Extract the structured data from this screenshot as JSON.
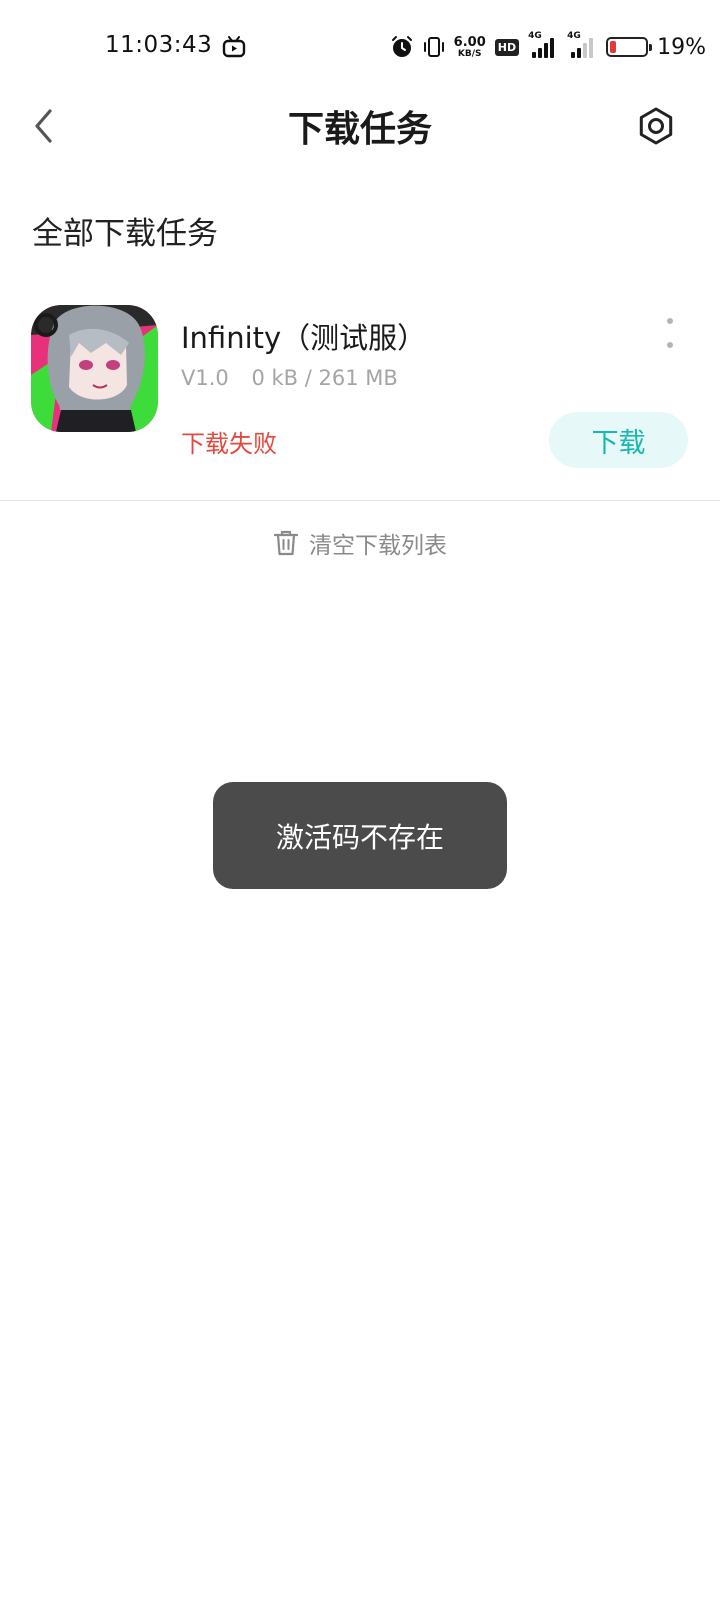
{
  "status_bar": {
    "time": "11:03:43",
    "net_speed_value": "6.00",
    "net_speed_unit": "KB/S",
    "hd_label": "HD",
    "sim1_label": "4G",
    "sim2_label": "4G",
    "battery_percent_text": "19%",
    "battery_level": 0.19,
    "battery_color": "#e53935"
  },
  "header": {
    "title": "下载任务",
    "back_icon": "chevron-left-icon",
    "settings_icon": "gear-icon"
  },
  "section": {
    "title": "全部下载任务"
  },
  "download_item": {
    "app_name": "Infinity（测试服）",
    "version": "V1.0",
    "size_progress": "0 kB / 261 MB",
    "status": "下载失败",
    "status_color": "#e5493d",
    "action_label": "下载",
    "action_color": "#19b7b2"
  },
  "clear_list": {
    "label": "清空下载列表",
    "icon": "trash-icon"
  },
  "toast": {
    "message": "激活码不存在"
  }
}
